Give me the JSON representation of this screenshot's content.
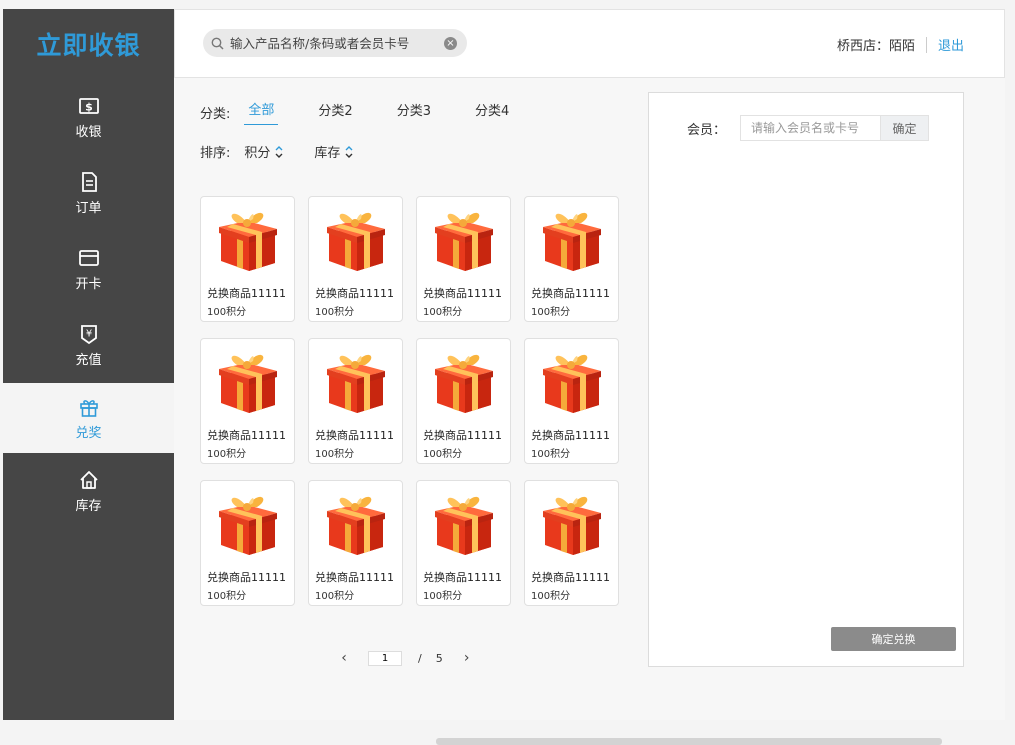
{
  "app": {
    "logo": "立即收银"
  },
  "sidebar": {
    "items": [
      {
        "label": "收银",
        "icon": "cash-register-icon"
      },
      {
        "label": "订单",
        "icon": "order-document-icon"
      },
      {
        "label": "开卡",
        "icon": "card-icon"
      },
      {
        "label": "充值",
        "icon": "recharge-yen-icon"
      },
      {
        "label": "兑奖",
        "icon": "gift-icon"
      },
      {
        "label": "库存",
        "icon": "home-icon"
      }
    ],
    "active_index": 4
  },
  "header": {
    "search": {
      "placeholder": "输入产品名称/条码或者会员卡号"
    },
    "store_label": "桥西店：陌陌",
    "logout_label": "退出"
  },
  "filters": {
    "category_label": "分类:",
    "categories": [
      "全部",
      "分类2",
      "分类3",
      "分类4"
    ],
    "active_category": 0,
    "sort_label": "排序:",
    "sort_options": [
      "积分",
      "库存"
    ]
  },
  "products": [
    {
      "name": "兑换商品11111",
      "points": "100积分"
    },
    {
      "name": "兑换商品11111",
      "points": "100积分"
    },
    {
      "name": "兑换商品11111",
      "points": "100积分"
    },
    {
      "name": "兑换商品11111",
      "points": "100积分"
    },
    {
      "name": "兑换商品11111",
      "points": "100积分"
    },
    {
      "name": "兑换商品11111",
      "points": "100积分"
    },
    {
      "name": "兑换商品11111",
      "points": "100积分"
    },
    {
      "name": "兑换商品11111",
      "points": "100积分"
    },
    {
      "name": "兑换商品11111",
      "points": "100积分"
    },
    {
      "name": "兑换商品11111",
      "points": "100积分"
    },
    {
      "name": "兑换商品11111",
      "points": "100积分"
    },
    {
      "name": "兑换商品11111",
      "points": "100积分"
    }
  ],
  "pagination": {
    "current": "1",
    "separator": "/",
    "total": "5"
  },
  "member_panel": {
    "member_label": "会员：",
    "input_placeholder": "请输入会员名或卡号",
    "confirm_label": "确定",
    "redeem_label": "确定兑换"
  },
  "colors": {
    "accent": "#2f9ad8",
    "sidebar_bg": "#464646",
    "redeem_button": "#8b8b8b"
  }
}
